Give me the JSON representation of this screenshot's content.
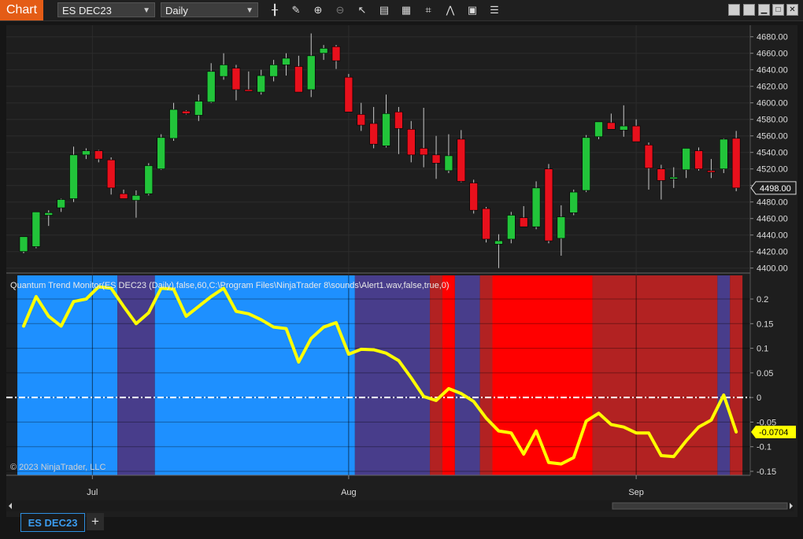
{
  "toolbar": {
    "chart_tab": "Chart",
    "instrument": "ES DEC23",
    "interval": "Daily",
    "tools": [
      "bar-type-icon",
      "pencil-icon",
      "zoom-in-icon",
      "zoom-out-icon",
      "pointer-icon",
      "data-box-icon",
      "properties-icon",
      "indicators-icon",
      "strategies-icon",
      "templates-icon",
      "menu-list-icon"
    ]
  },
  "indicator_label": "Quantum Trend Monitor(ES DEC23 (Daily),false,60,C:\\Program Files\\NinjaTrader 8\\sounds\\Alert1.wav,false,true,0)",
  "copyright": "© 2023 NinjaTrader, LLC",
  "bottom_tab": "ES DEC23",
  "colors": {
    "up_candle": "#22c43a",
    "down_candle": "#e8101c",
    "line": "#ffff00",
    "band_light_blue": "#1e90ff",
    "band_purple": "#483d8b",
    "band_red": "#ff0000",
    "band_dark_red": "#b22222"
  },
  "chart_data": [
    {
      "type": "candlestick",
      "title": "",
      "y_ticks": [
        4400,
        4420,
        4440,
        4460,
        4480,
        4500,
        4520,
        4540,
        4560,
        4580,
        4600,
        4620,
        4640,
        4660,
        4680
      ],
      "ylim": [
        4394,
        4694
      ],
      "last_price_label": "4498.00",
      "x_labels": [
        {
          "label": "Jul",
          "index": 5.5
        },
        {
          "label": "Aug",
          "index": 26
        },
        {
          "label": "Sep",
          "index": 49
        }
      ],
      "candles": [
        {
          "o": 4420,
          "h": 4432,
          "l": 4418,
          "c": 4438
        },
        {
          "o": 4426,
          "h": 4466,
          "l": 4424,
          "c": 4468
        },
        {
          "o": 4464,
          "h": 4470,
          "l": 4451,
          "c": 4467
        },
        {
          "o": 4473,
          "h": 4484,
          "l": 4468,
          "c": 4483
        },
        {
          "o": 4484,
          "h": 4547,
          "l": 4480,
          "c": 4537
        },
        {
          "o": 4537,
          "h": 4545,
          "l": 4532,
          "c": 4542
        },
        {
          "o": 4542,
          "h": 4543,
          "l": 4528,
          "c": 4532
        },
        {
          "o": 4531,
          "h": 4534,
          "l": 4489,
          "c": 4497
        },
        {
          "o": 4490,
          "h": 4495,
          "l": 4487,
          "c": 4484
        },
        {
          "o": 4482,
          "h": 4494,
          "l": 4461,
          "c": 4488
        },
        {
          "o": 4490,
          "h": 4527,
          "l": 4488,
          "c": 4524
        },
        {
          "o": 4520,
          "h": 4562,
          "l": 4519,
          "c": 4558
        },
        {
          "o": 4557,
          "h": 4600,
          "l": 4554,
          "c": 4592
        },
        {
          "o": 4590,
          "h": 4591,
          "l": 4586,
          "c": 4587
        },
        {
          "o": 4585,
          "h": 4610,
          "l": 4578,
          "c": 4602
        },
        {
          "o": 4601,
          "h": 4648,
          "l": 4600,
          "c": 4638
        },
        {
          "o": 4632,
          "h": 4660,
          "l": 4628,
          "c": 4646
        },
        {
          "o": 4642,
          "h": 4646,
          "l": 4603,
          "c": 4616
        },
        {
          "o": 4616,
          "h": 4638,
          "l": 4614,
          "c": 4614
        },
        {
          "o": 4613,
          "h": 4640,
          "l": 4610,
          "c": 4633
        },
        {
          "o": 4632,
          "h": 4652,
          "l": 4626,
          "c": 4646
        },
        {
          "o": 4646,
          "h": 4660,
          "l": 4633,
          "c": 4654
        },
        {
          "o": 4644,
          "h": 4657,
          "l": 4613,
          "c": 4613
        },
        {
          "o": 4616,
          "h": 4684,
          "l": 4607,
          "c": 4657
        },
        {
          "o": 4660,
          "h": 4670,
          "l": 4652,
          "c": 4666
        },
        {
          "o": 4668,
          "h": 4670,
          "l": 4641,
          "c": 4651
        },
        {
          "o": 4631,
          "h": 4635,
          "l": 4593,
          "c": 4589
        },
        {
          "o": 4586,
          "h": 4600,
          "l": 4566,
          "c": 4573
        },
        {
          "o": 4575,
          "h": 4595,
          "l": 4545,
          "c": 4550
        },
        {
          "o": 4548,
          "h": 4610,
          "l": 4546,
          "c": 4587
        },
        {
          "o": 4589,
          "h": 4595,
          "l": 4538,
          "c": 4569
        },
        {
          "o": 4568,
          "h": 4578,
          "l": 4528,
          "c": 4537
        },
        {
          "o": 4545,
          "h": 4594,
          "l": 4522,
          "c": 4537
        },
        {
          "o": 4537,
          "h": 4560,
          "l": 4508,
          "c": 4527
        },
        {
          "o": 4518,
          "h": 4562,
          "l": 4515,
          "c": 4536
        },
        {
          "o": 4556,
          "h": 4567,
          "l": 4504,
          "c": 4505
        },
        {
          "o": 4503,
          "h": 4507,
          "l": 4466,
          "c": 4470
        },
        {
          "o": 4472,
          "h": 4474,
          "l": 4431,
          "c": 4435
        },
        {
          "o": 4429,
          "h": 4441,
          "l": 4400,
          "c": 4433
        },
        {
          "o": 4435,
          "h": 4468,
          "l": 4430,
          "c": 4464
        },
        {
          "o": 4461,
          "h": 4475,
          "l": 4452,
          "c": 4450
        },
        {
          "o": 4450,
          "h": 4505,
          "l": 4447,
          "c": 4497
        },
        {
          "o": 4520,
          "h": 4526,
          "l": 4430,
          "c": 4433
        },
        {
          "o": 4436,
          "h": 4476,
          "l": 4415,
          "c": 4462
        },
        {
          "o": 4467,
          "h": 4495,
          "l": 4464,
          "c": 4492
        },
        {
          "o": 4494,
          "h": 4561,
          "l": 4492,
          "c": 4558
        },
        {
          "o": 4559,
          "h": 4577,
          "l": 4556,
          "c": 4577
        },
        {
          "o": 4576,
          "h": 4587,
          "l": 4572,
          "c": 4568
        },
        {
          "o": 4567,
          "h": 4597,
          "l": 4559,
          "c": 4572
        },
        {
          "o": 4572,
          "h": 4580,
          "l": 4555,
          "c": 4553
        },
        {
          "o": 4549,
          "h": 4552,
          "l": 4495,
          "c": 4521
        },
        {
          "o": 4520,
          "h": 4525,
          "l": 4483,
          "c": 4506
        },
        {
          "o": 4508,
          "h": 4522,
          "l": 4497,
          "c": 4510
        },
        {
          "o": 4519,
          "h": 4543,
          "l": 4509,
          "c": 4545
        },
        {
          "o": 4542,
          "h": 4546,
          "l": 4518,
          "c": 4520
        },
        {
          "o": 4518,
          "h": 4532,
          "l": 4509,
          "c": 4516
        },
        {
          "o": 4520,
          "h": 4557,
          "l": 4515,
          "c": 4556
        },
        {
          "o": 4557,
          "h": 4566,
          "l": 4493,
          "c": 4497
        }
      ]
    },
    {
      "type": "line",
      "title": "",
      "y_ticks": [
        0.2,
        0.15,
        0.1,
        0.05,
        0,
        -0.05,
        -0.1,
        -0.15
      ],
      "ylim": [
        -0.158,
        0.248
      ],
      "last_value_label": "-0.0704",
      "series": [
        {
          "values": [
            0.145,
            0.205,
            0.165,
            0.145,
            0.195,
            0.2,
            0.225,
            0.222,
            0.185,
            0.15,
            0.172,
            0.222,
            0.22,
            0.165,
            0.185,
            0.205,
            0.222,
            0.175,
            0.17,
            0.158,
            0.143,
            0.14,
            0.072,
            0.12,
            0.143,
            0.152,
            0.088,
            0.098,
            0.097,
            0.09,
            0.075,
            0.04,
            0.002,
            -0.006,
            0.018,
            0.008,
            -0.008,
            -0.042,
            -0.068,
            -0.072,
            -0.115,
            -0.068,
            -0.132,
            -0.135,
            -0.122,
            -0.048,
            -0.032,
            -0.055,
            -0.06,
            -0.072,
            -0.072,
            -0.118,
            -0.12,
            -0.088,
            -0.06,
            -0.046,
            0.005,
            -0.07
          ]
        }
      ],
      "zero_line": 0,
      "bands": [
        {
          "start": 0,
          "end": 7,
          "color": "band_light_blue"
        },
        {
          "start": 8,
          "end": 10,
          "color": "band_purple"
        },
        {
          "start": 11,
          "end": 26,
          "color": "band_light_blue"
        },
        {
          "start": 27,
          "end": 32,
          "color": "band_purple"
        },
        {
          "start": 33,
          "end": 33,
          "color": "band_dark_red"
        },
        {
          "start": 34,
          "end": 34,
          "color": "band_red"
        },
        {
          "start": 35,
          "end": 36,
          "color": "band_purple"
        },
        {
          "start": 37,
          "end": 37,
          "color": "band_dark_red"
        },
        {
          "start": 38,
          "end": 45,
          "color": "band_red"
        },
        {
          "start": 46,
          "end": 55,
          "color": "band_dark_red"
        },
        {
          "start": 56,
          "end": 56,
          "color": "band_purple"
        },
        {
          "start": 57,
          "end": 57,
          "color": "band_dark_red"
        }
      ]
    }
  ]
}
